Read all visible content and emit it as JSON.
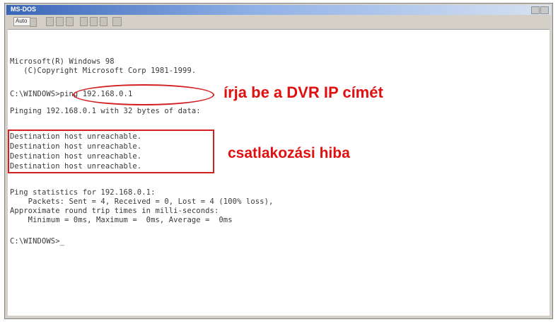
{
  "window": {
    "title": "MS-DOS",
    "toolbar": {
      "font_size": "Auto",
      "button_icons": [
        "mark-icon",
        "copy-icon",
        "paste-icon",
        "fullscreen-icon",
        "properties-icon",
        "background-icon",
        "font-icon"
      ]
    }
  },
  "console": {
    "lines": [
      "Microsoft(R) Windows 98",
      "   (C)Copyright Microsoft Corp 1981-1999.",
      "",
      "C:\\WINDOWS>ping 192.168.0.1",
      "Pinging 192.168.0.1 with 32 bytes of data:",
      "",
      "Destination host unreachable.",
      "Destination host unreachable.",
      "Destination host unreachable.",
      "Destination host unreachable.",
      "",
      "Ping statistics for 192.168.0.1:",
      "    Packets: Sent = 4, Received = 0, Lost = 4 (100% loss),",
      "Approximate round trip times in milli-seconds:",
      "    Minimum = 0ms, Maximum =  0ms, Average =  0ms",
      "",
      "C:\\WINDOWS>_"
    ]
  },
  "annotations": {
    "ip_hint": "írja be a DVR IP címét",
    "error_hint": "csatlakozási hiba",
    "color": "#e01010"
  }
}
